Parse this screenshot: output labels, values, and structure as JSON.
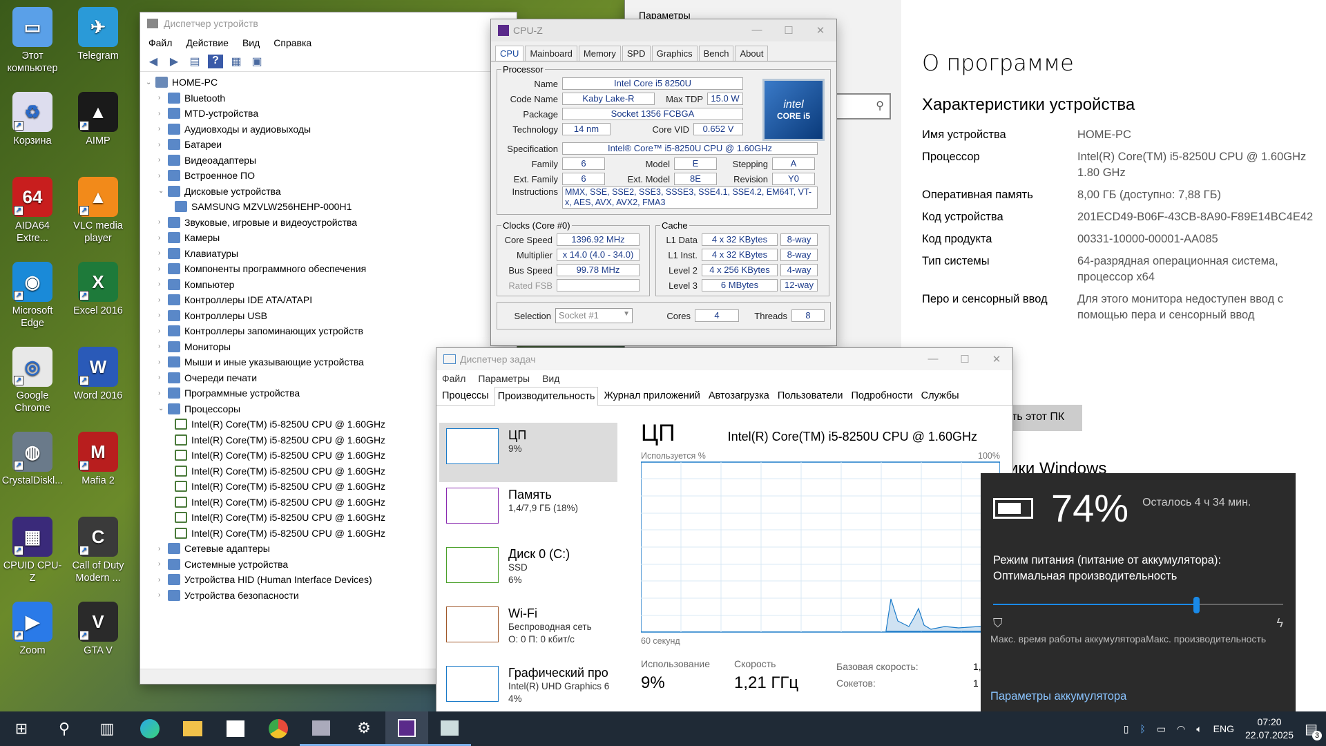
{
  "desktop": {
    "icons": [
      {
        "label": "Этот компьютер",
        "icon": "computer-icon"
      },
      {
        "label": "Telegram",
        "icon": "telegram-icon"
      },
      {
        "label": "Корзина",
        "icon": "recycle-bin-icon"
      },
      {
        "label": "AIMP",
        "icon": "aimp-icon"
      },
      {
        "label": "AIDA64 Extre...",
        "icon": "aida64-icon"
      },
      {
        "label": "VLC media player",
        "icon": "vlc-icon"
      },
      {
        "label": "Microsoft Edge",
        "icon": "edge-icon"
      },
      {
        "label": "Excel 2016",
        "icon": "excel-icon"
      },
      {
        "label": "Google Chrome",
        "icon": "chrome-icon"
      },
      {
        "label": "Word 2016",
        "icon": "word-icon"
      },
      {
        "label": "CrystalDiskl...",
        "icon": "crystaldisk-icon"
      },
      {
        "label": "Mafia 2",
        "icon": "mafia-icon"
      },
      {
        "label": "CPUID CPU-Z",
        "icon": "cpuz-icon"
      },
      {
        "label": "Call of Duty Modern ...",
        "icon": "cod-icon"
      },
      {
        "label": "Zoom",
        "icon": "zoom-icon"
      },
      {
        "label": "GTA V",
        "icon": "gta-icon"
      }
    ]
  },
  "device_manager": {
    "title": "Диспетчер устройств",
    "menu": [
      "Файл",
      "Действие",
      "Вид",
      "Справка"
    ],
    "root": "HOME-PC",
    "tree": [
      {
        "label": "Bluetooth",
        "level": 1
      },
      {
        "label": "MTD-устройства",
        "level": 1
      },
      {
        "label": "Аудиовходы и аудиовыходы",
        "level": 1
      },
      {
        "label": "Батареи",
        "level": 1
      },
      {
        "label": "Видеоадаптеры",
        "level": 1
      },
      {
        "label": "Встроенное ПО",
        "level": 1
      },
      {
        "label": "Дисковые устройства",
        "level": 1
      },
      {
        "label": "SAMSUNG MZVLW256HEHP-000H1",
        "level": 2
      },
      {
        "label": "Звуковые, игровые и видеоустройства",
        "level": 1
      },
      {
        "label": "Камеры",
        "level": 1
      },
      {
        "label": "Клавиатуры",
        "level": 1
      },
      {
        "label": "Компоненты программного обеспечения",
        "level": 1
      },
      {
        "label": "Компьютер",
        "level": 1
      },
      {
        "label": "Контроллеры IDE ATA/ATAPI",
        "level": 1
      },
      {
        "label": "Контроллеры USB",
        "level": 1
      },
      {
        "label": "Контроллеры запоминающих устройств",
        "level": 1
      },
      {
        "label": "Мониторы",
        "level": 1
      },
      {
        "label": "Мыши и иные указывающие устройства",
        "level": 1
      },
      {
        "label": "Очереди печати",
        "level": 1
      },
      {
        "label": "Программные устройства",
        "level": 1
      },
      {
        "label": "Процессоры",
        "level": 1
      },
      {
        "label": "Intel(R) Core(TM) i5-8250U CPU @ 1.60GHz",
        "level": 2
      },
      {
        "label": "Intel(R) Core(TM) i5-8250U CPU @ 1.60GHz",
        "level": 2
      },
      {
        "label": "Intel(R) Core(TM) i5-8250U CPU @ 1.60GHz",
        "level": 2
      },
      {
        "label": "Intel(R) Core(TM) i5-8250U CPU @ 1.60GHz",
        "level": 2
      },
      {
        "label": "Intel(R) Core(TM) i5-8250U CPU @ 1.60GHz",
        "level": 2
      },
      {
        "label": "Intel(R) Core(TM) i5-8250U CPU @ 1.60GHz",
        "level": 2
      },
      {
        "label": "Intel(R) Core(TM) i5-8250U CPU @ 1.60GHz",
        "level": 2
      },
      {
        "label": "Intel(R) Core(TM) i5-8250U CPU @ 1.60GHz",
        "level": 2
      },
      {
        "label": "Сетевые адаптеры",
        "level": 1
      },
      {
        "label": "Системные устройства",
        "level": 1
      },
      {
        "label": "Устройства HID (Human Interface Devices)",
        "level": 1
      },
      {
        "label": "Устройства безопасности",
        "level": 1
      }
    ]
  },
  "cpuz": {
    "title": "CPU-Z",
    "tabs": [
      "CPU",
      "Mainboard",
      "Memory",
      "SPD",
      "Graphics",
      "Bench",
      "About"
    ],
    "processor_legend": "Processor",
    "name_label": "Name",
    "name": "Intel Core i5 8250U",
    "codename_label": "Code Name",
    "codename": "Kaby Lake-R",
    "maxtdp_label": "Max TDP",
    "maxtdp": "15.0 W",
    "package_label": "Package",
    "package": "Socket 1356 FCBGA",
    "technology_label": "Technology",
    "technology": "14 nm",
    "corevid_label": "Core VID",
    "corevid": "0.652 V",
    "spec_label": "Specification",
    "spec": "Intel® Core™ i5-8250U CPU @ 1.60GHz",
    "family_label": "Family",
    "family": "6",
    "model_label": "Model",
    "model": "E",
    "stepping_label": "Stepping",
    "stepping": "A",
    "extfamily_label": "Ext. Family",
    "extfamily": "6",
    "extmodel_label": "Ext. Model",
    "extmodel": "8E",
    "revision_label": "Revision",
    "revision": "Y0",
    "instructions_label": "Instructions",
    "instructions": "MMX, SSE, SSE2, SSE3, SSSE3, SSE4.1, SSE4.2, EM64T, VT-x, AES, AVX, AVX2, FMA3",
    "clocks_legend": "Clocks (Core #0)",
    "corespeed_label": "Core Speed",
    "corespeed": "1396.92 MHz",
    "multiplier_label": "Multiplier",
    "multiplier": "x 14.0 (4.0 - 34.0)",
    "busspeed_label": "Bus Speed",
    "busspeed": "99.78 MHz",
    "ratedfsb_label": "Rated FSB",
    "cache_legend": "Cache",
    "l1data_label": "L1 Data",
    "l1data": "4 x 32 KBytes",
    "l1data_way": "8-way",
    "l1inst_label": "L1 Inst.",
    "l1inst": "4 x 32 KBytes",
    "l1inst_way": "8-way",
    "l2_label": "Level 2",
    "l2": "4 x 256 KBytes",
    "l2_way": "4-way",
    "l3_label": "Level 3",
    "l3": "6 MBytes",
    "l3_way": "12-way",
    "selection_label": "Selection",
    "selection": "Socket #1",
    "cores_label": "Cores",
    "cores": "4",
    "threads_label": "Threads",
    "threads": "8",
    "logo_text": "CORE i5"
  },
  "task_manager": {
    "title": "Диспетчер задач",
    "menu": [
      "Файл",
      "Параметры",
      "Вид"
    ],
    "tabs": [
      "Процессы",
      "Производительность",
      "Журнал приложений",
      "Автозагрузка",
      "Пользователи",
      "Подробности",
      "Службы"
    ],
    "side": [
      {
        "name": "ЦП",
        "sub1": "9%",
        "sub2": "",
        "color": "#1a7ac8"
      },
      {
        "name": "Память",
        "sub1": "1,4/7,9 ГБ (18%)",
        "sub2": "",
        "color": "#8a2ab0"
      },
      {
        "name": "Диск 0 (C:)",
        "sub1": "SSD",
        "sub2": "6%",
        "color": "#4aa02a"
      },
      {
        "name": "Wi-Fi",
        "sub1": "Беспроводная сеть",
        "sub2": "О: 0 П: 0 кбит/с",
        "color": "#a0582a"
      },
      {
        "name": "Графический про",
        "sub1": "Intel(R) UHD Graphics 6",
        "sub2": "4%",
        "color": "#1a7ac8"
      }
    ],
    "cpu_heading": "ЦП",
    "cpu_name": "Intel(R) Core(TM) i5-8250U CPU @ 1.60GHz",
    "usage_axis": "Используется %",
    "usage_max": "100%",
    "time_axis": "60 секунд",
    "util_label": "Использование",
    "util_value": "9%",
    "speed_label": "Скорость",
    "speed_value": "1,21 ГГц",
    "base_speed_label": "Базовая скорость:",
    "base_speed_value": "1,",
    "sockets_label": "Сокетов:",
    "sockets_value": "1"
  },
  "settings": {
    "window_title": "Параметры",
    "page_title": "О программе",
    "section": "Характеристики устройства",
    "rows": [
      {
        "k": "Имя устройства",
        "v": "HOME-PC"
      },
      {
        "k": "Процессор",
        "v": "Intel(R) Core(TM) i5-8250U CPU @ 1.60GHz 1.80 GHz"
      },
      {
        "k": "Оперативная память",
        "v": "8,00 ГБ (доступно: 7,88 ГБ)"
      },
      {
        "k": "Код устройства",
        "v": "201ECD49-B06F-43CB-8A90-F89E14BC4E42"
      },
      {
        "k": "Код продукта",
        "v": "00331-10000-00001-AA085"
      },
      {
        "k": "Тип системы",
        "v": "64-разрядная операционная система, процессор x64"
      },
      {
        "k": "Перо и сенсорный ввод",
        "v": "Для этого монитора недоступен ввод с помощью пера и сенсорный ввод"
      }
    ],
    "rename_button": "ть этот ПК",
    "win_section_partial": "тики Windows"
  },
  "battery": {
    "percent": "74%",
    "remaining": "Осталось 4 ч 34 мин.",
    "mode_label": "Режим питания (питание от аккумулятора):",
    "mode_value": "Оптимальная производительность",
    "slider_level": 0.7,
    "left_label": "Макс. время работы аккумулятора",
    "right_label": "Макс. производительность",
    "settings_link": "Параметры аккумулятора"
  },
  "taskbar": {
    "lang": "ENG",
    "time": "07:20",
    "date": "22.07.2025",
    "notif_count": "3"
  }
}
